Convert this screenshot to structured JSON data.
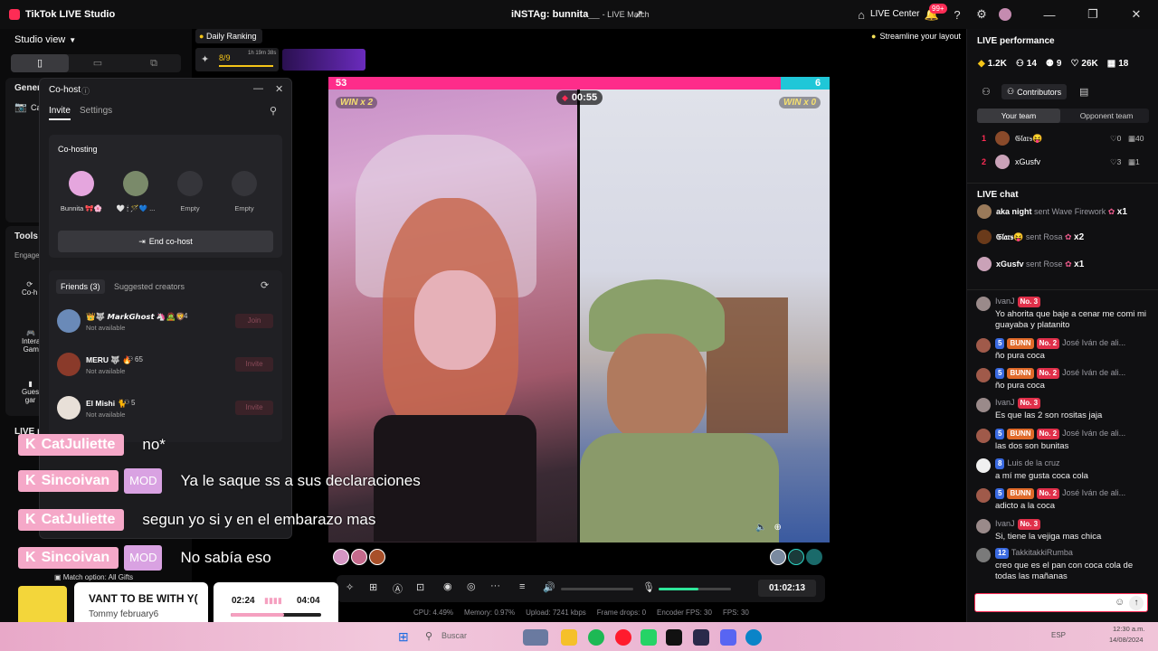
{
  "titlebar": {
    "app": "TikTok LIVE Studio",
    "live_title": "iNSTAg: bunnita__",
    "live_mode": "- LIVE Match",
    "live_center": "LIVE Center",
    "notif_badge": "99+"
  },
  "left": {
    "studio_view": "Studio view",
    "general_label": "Gener",
    "ca_label": "Ca",
    "tools_label": "Tools",
    "engage_label": "Engage",
    "cohost_label": "Co-h",
    "interactive_label1": "Intera",
    "interactive_label2": "Gam",
    "guest_label1": "Gues",
    "guest_label2": "gar",
    "live_label": "LIVE r",
    "daily_ranking": "Daily Ranking",
    "rank_value": "8/9",
    "rank_timer": "1h 19m 38s"
  },
  "cohost": {
    "title": "Co-host",
    "tabs": [
      "Invite",
      "Settings"
    ],
    "section": "Co-hosting",
    "slots": [
      {
        "name": "Bunnita 🎀🌸"
      },
      {
        "name": "🤍 🕯 🪄💙 ..."
      },
      {
        "name": "Empty"
      },
      {
        "name": "Empty"
      }
    ],
    "end_button": "End co-host",
    "list_tabs": [
      "Friends (3)",
      "Suggested creators"
    ],
    "friends": [
      {
        "name": "👑🐺 𝙈𝙖𝙧𝙠𝙂𝙝𝙤𝙨𝙩 🦄🧟🦁",
        "count": "4",
        "status": "Not available",
        "action": "Join"
      },
      {
        "name": "MERU 🐺 🔥",
        "count": "65",
        "status": "Not available",
        "action": "Invite"
      },
      {
        "name": "El Mishi 🐈",
        "count": "5",
        "status": "Not available",
        "action": "Invite"
      }
    ]
  },
  "stage": {
    "score_left": "53",
    "score_right": "6",
    "win_left": "WIN x 2",
    "win_right": "WIN x 0",
    "timer": "00:55"
  },
  "overlay_chat": [
    {
      "user": "CatJuliette",
      "mod": false,
      "text": "no*"
    },
    {
      "user": "Sincoivan",
      "mod": true,
      "text": "Ya le saque ss a sus declaraciones"
    },
    {
      "user": "CatJuliette",
      "mod": false,
      "text": "segun yo si y en el embarazo mas"
    },
    {
      "user": "Sincoivan",
      "mod": true,
      "text": "No sabía eso"
    }
  ],
  "overlay": {
    "mod_label": "MOD",
    "match_option": "Match option: All Gifts",
    "music_title": "VANT TO BE WITH Y(",
    "music_artist": "Tommy february6",
    "music_time_left": "02:24",
    "music_time_right": "04:04",
    "music_progress": 0.59
  },
  "controls": {
    "duration": "01:02:13",
    "volume_level": 0.0,
    "mic_level": 0.55
  },
  "stats": {
    "cpu": "CPU: 4.49%",
    "memory": "Memory: 0.97%",
    "upload": "Upload: 7241 kbps",
    "frame_drops": "Frame drops: 0",
    "encoder_fps": "Encoder FPS: 30",
    "fps": "FPS: 30"
  },
  "center_top": {
    "tip": "Streamline your layout"
  },
  "right": {
    "performance_title": "LIVE performance",
    "stats": [
      "1.2K",
      "14",
      "9",
      "26K",
      "18"
    ],
    "contributors": "Contributors",
    "team_tabs": [
      "Your team",
      "Opponent team"
    ],
    "contributors_list": [
      {
        "rank": "1",
        "name": "𝔊𝔩𝔞𝔯𝔰😝",
        "likes": "0",
        "gifts": "40"
      },
      {
        "rank": "2",
        "name": "xGusfv",
        "likes": "3",
        "gifts": "1"
      }
    ],
    "live_chat": "LIVE chat",
    "gift_events": [
      {
        "user": "aka night",
        "sent": "sent Wave Firework",
        "count": "x1"
      },
      {
        "user": "𝔊𝔩𝔞𝔯𝔰😝",
        "sent": "sent Rosa",
        "count": "x2"
      },
      {
        "user": "xGusfv",
        "sent": "sent Rose",
        "count": "x1"
      }
    ],
    "messages": [
      {
        "badges": [
          "No. 3"
        ],
        "name": "IvanJ",
        "text": "Yo ahorita que baje a cenar me comi mi guayaba y platanito"
      },
      {
        "badges": [
          "5",
          "BUNN",
          "No. 2"
        ],
        "name": "José Iván de ali...",
        "text": "ño pura coca"
      },
      {
        "badges": [
          "5",
          "BUNN",
          "No. 2"
        ],
        "name": "José Iván de ali...",
        "text": "ño pura coca"
      },
      {
        "badges": [
          "No. 3"
        ],
        "name": "IvanJ",
        "text": "Es que las 2 son rositas jaja"
      },
      {
        "badges": [
          "5",
          "BUNN",
          "No. 2"
        ],
        "name": "José Iván de ali...",
        "text": "las dos son bunitas"
      },
      {
        "badges": [
          "8"
        ],
        "name": "Luis de la cruz",
        "text": "a mí me gusta coca cola"
      },
      {
        "badges": [
          "5",
          "BUNN",
          "No. 2"
        ],
        "name": "José Iván de ali...",
        "text": "adicto a la coca"
      },
      {
        "badges": [
          "No. 3"
        ],
        "name": "IvanJ",
        "text": "Si, tiene la vejiga mas chica"
      },
      {
        "badges": [
          "12"
        ],
        "name": "TakkitakkiRumba",
        "text": "creo que es el pan con coca cola de todas las mañanas"
      }
    ],
    "input_placeholder": ""
  },
  "taskbar": {
    "search": "Buscar",
    "lang": "ESP",
    "time": "12:30 a.m.",
    "date": "14/08/2024"
  }
}
